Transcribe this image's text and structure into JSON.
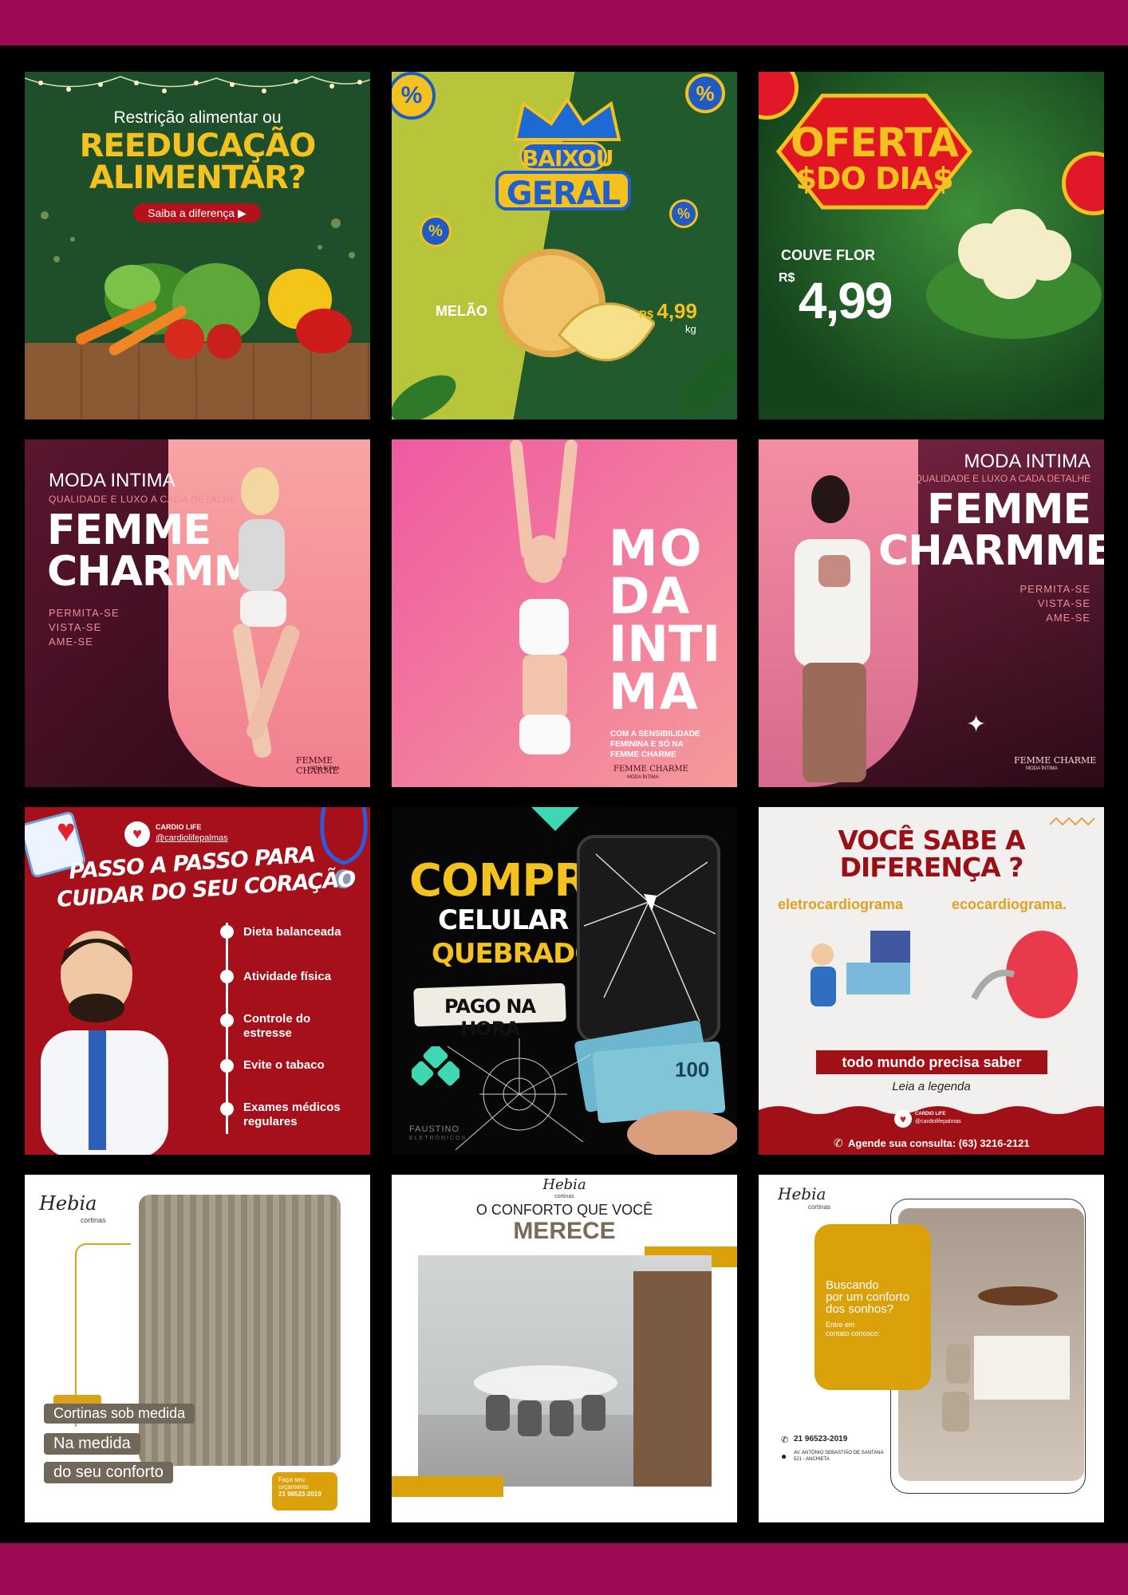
{
  "tiles": {
    "t1": {
      "line1": "Restrição alimentar ou",
      "line2": "REEDUCAÇÃO",
      "line3": "ALIMENTAR?",
      "button": "Saiba a diferença"
    },
    "t2": {
      "badge_top": "BAIXOU",
      "badge_bottom": "GERAL",
      "product": "MELÃO",
      "currency": "R$",
      "price": "4,99",
      "unit": "kg",
      "percent": "%"
    },
    "t3": {
      "title1": "OFERTA",
      "title2": "$DO DIA$",
      "product": "COUVE FLOR",
      "currency": "R$",
      "price": "4,99"
    },
    "t4": {
      "kicker": "MODA INTIMA",
      "sub": "QUALIDADE E LUXO A CADA DETALHE",
      "brand1": "FEMME",
      "brand2": "CHARMME",
      "s1": "PERMITA-SE",
      "s2": "VISTA-SE",
      "s3": "AME-SE",
      "logo": "FEMME CHARME",
      "logo_sub": "MODA ÍNTIMA"
    },
    "t5": {
      "w1": "MO",
      "w2": "DA",
      "w3": "INTI",
      "w4": "MA",
      "d1": "COM A SENSIBILIDADE",
      "d2": "FEMININA E SÓ NA",
      "d3": "FEMME CHARME",
      "logo": "FEMME CHARME",
      "logo_sub": "MODA ÍNTIMA"
    },
    "t6": {
      "kicker": "MODA INTIMA",
      "sub": "QUALIDADE E LUXO A CADA DETALHE",
      "brand1": "FEMME",
      "brand2": "CHARMME",
      "s1": "PERMITA-SE",
      "s2": "VISTA-SE",
      "s3": "AME-SE",
      "logo": "FEMME CHARME",
      "logo_sub": "MODA ÍNTIMA"
    },
    "t7": {
      "brand": "CARDIO LIFE",
      "handle": "@cardiolifepalmas",
      "title1": "PASSO A PASSO PARA",
      "title2": "CUIDAR DO SEU CORAÇÃO",
      "steps": [
        "Dieta balanceada",
        "Atividade física",
        "Controle do estresse",
        "Evite o tabaco",
        "Exames médicos regulares"
      ]
    },
    "t8": {
      "l1": "COMPRO",
      "l2": "CELULAR",
      "l3": "QUEBRADO !!",
      "tag": "PAGO NA HORA",
      "note": "100",
      "logo": "FAUSTINO",
      "logo_sub": "ELETRÔNICOS"
    },
    "t9": {
      "title1": "VOCÊ SABE A",
      "title2": "DIFERENÇA ?",
      "left": "eletrocardiograma",
      "right": "ecocardiograma.",
      "banner": "todo mundo precisa saber",
      "caption": "Leia a legenda",
      "brand": "CARDIO LIFE",
      "handle": "@cardiolifepalmas",
      "phone": "Agende sua consulta: (63) 3216-2121"
    },
    "t10": {
      "logo": "Hebia",
      "logo_sub": "cortinas",
      "p1": "Cortinas sob medida",
      "p2": "Na medida",
      "p3": "do seu conforto",
      "cta1": "Faça seu",
      "cta2": "orçamento",
      "cta3": "21 96523-2019"
    },
    "t11": {
      "logo": "Hebia",
      "logo_sub": "cortinas",
      "line1": "O CONFORTO QUE VOCÊ",
      "line2": "MERECE"
    },
    "t12": {
      "logo": "Hebia",
      "logo_sub": "cortinas",
      "q1": "Buscando",
      "q2": "por um conforto",
      "q3": "dos sonhos?",
      "c1": "Entre em",
      "c2": "contato conosco:",
      "phone": "21 96523-2019",
      "addr1": "AV. ANTÔNIO SEBASTIÃO DE SANTANA",
      "addr2": "521 - ANCHIETA"
    }
  },
  "colors": {
    "band": "#9b0a52",
    "green_dark": "#1f5a2c",
    "yellow": "#f4c21f",
    "pink": "#f08b9a",
    "red": "#b5121b",
    "gold": "#dba10a"
  }
}
